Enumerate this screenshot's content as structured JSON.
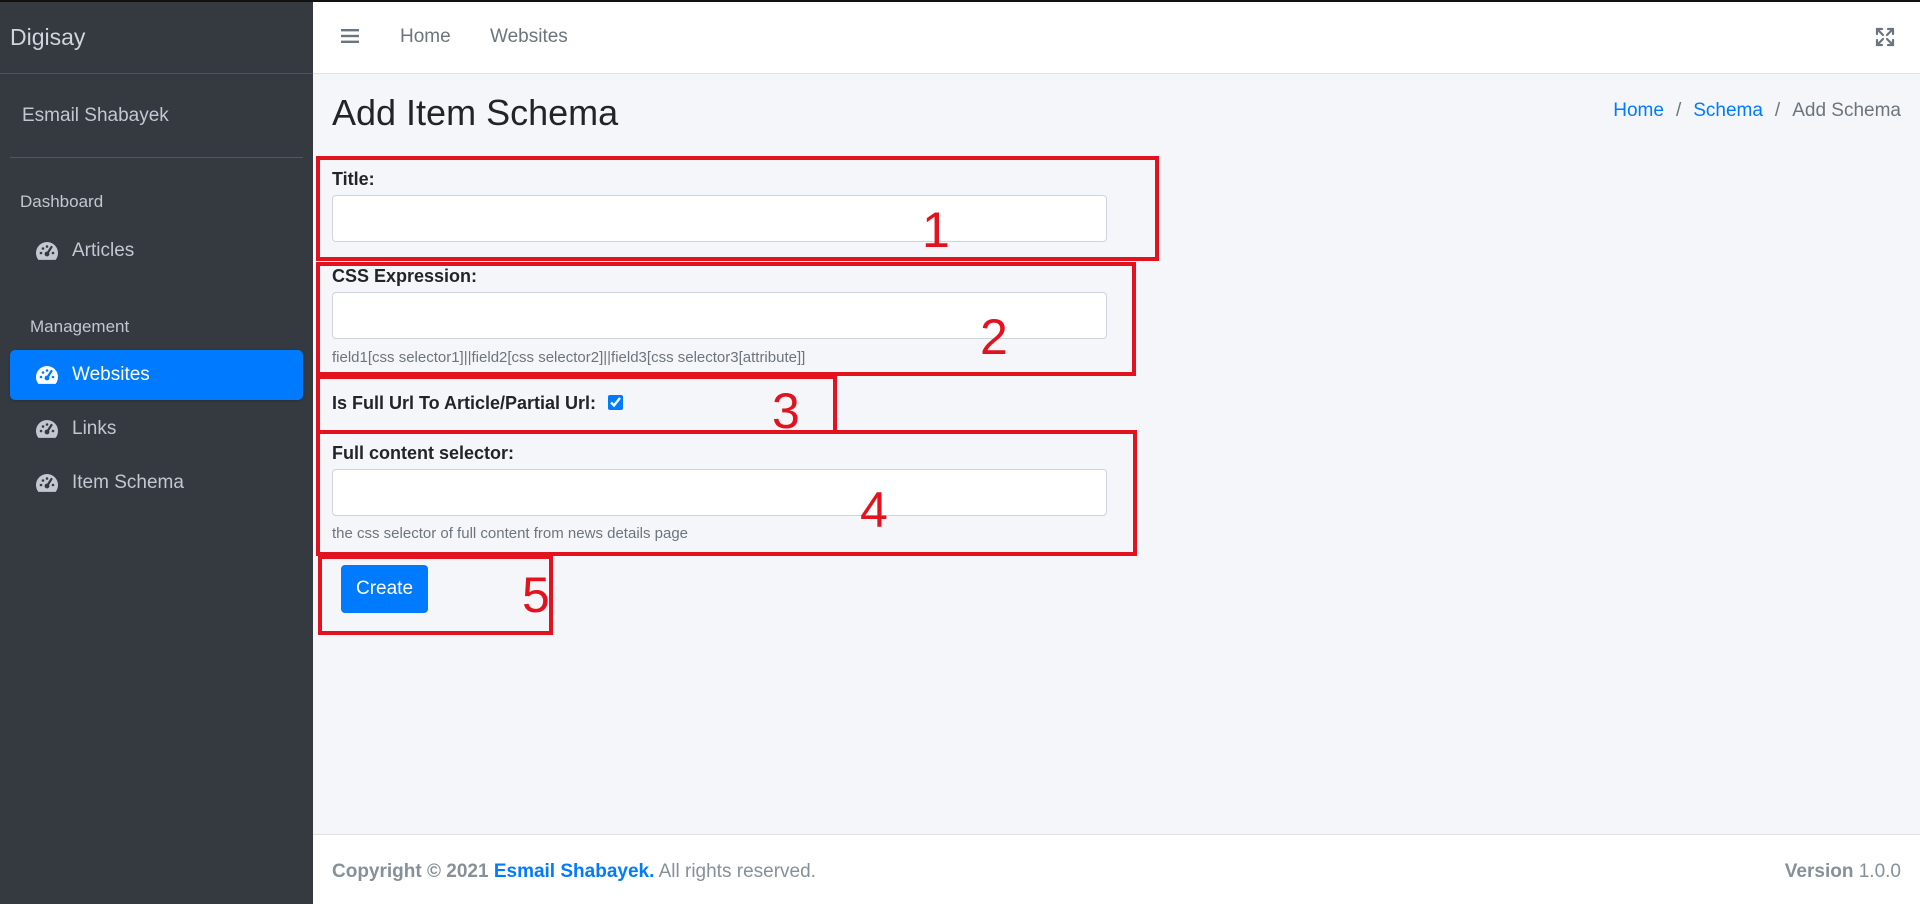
{
  "app": {
    "brand": "Digisay",
    "user": "Esmail Shabayek"
  },
  "sidebar": {
    "dashboard_header": "Dashboard",
    "management_header": "Management",
    "items": [
      {
        "label": "Articles",
        "icon": "tachometer-icon",
        "active": false
      },
      {
        "label": "Websites",
        "icon": "tachometer-icon",
        "active": true
      },
      {
        "label": "Links",
        "icon": "tachometer-icon",
        "active": false
      },
      {
        "label": "Item Schema",
        "icon": "tachometer-icon",
        "active": false
      }
    ]
  },
  "navbar": {
    "home": "Home",
    "websites": "Websites"
  },
  "page": {
    "title": "Add Item Schema",
    "breadcrumb": {
      "home": "Home",
      "schema": "Schema",
      "current": "Add Schema"
    }
  },
  "form": {
    "title_label": "Title:",
    "title_value": "",
    "css_label": "CSS Expression:",
    "css_value": "",
    "css_help": "field1[css selector1]||field2[css selector2]||field3[css selector3[attribute]]",
    "full_url_label": "Is Full Url To Article/Partial Url:",
    "full_url_checked": true,
    "content_label": "Full content selector:",
    "content_value": "",
    "content_help": "the css selector of full content from news details page",
    "submit": "Create"
  },
  "annotations": [
    "1",
    "2",
    "3",
    "4",
    "5"
  ],
  "footer": {
    "copyright": "Copyright © 2021",
    "author": "Esmail Shabayek.",
    "rights": "All rights reserved.",
    "version_label": "Version",
    "version": "1.0.0"
  },
  "colors": {
    "accent": "#007bff",
    "sidebar_bg": "#343a40",
    "annotation": "#e3121f"
  }
}
